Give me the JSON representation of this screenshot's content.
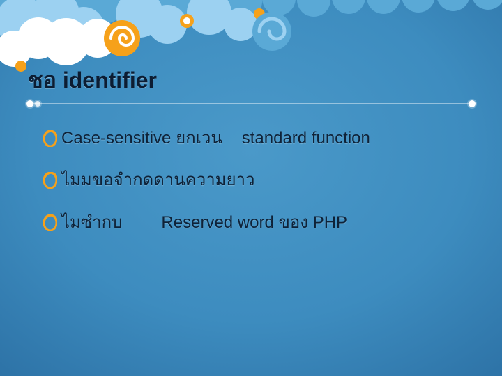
{
  "title": "ชอ      identifier",
  "bullets": [
    {
      "pre": "Case-sensitive ยกเวน",
      "post": "standard function"
    },
    {
      "pre": "ไมมขอจำกดดานความยาว",
      "post": ""
    },
    {
      "pre": "ไมซำกบ",
      "post": "Reserved word ของ PHP"
    }
  ],
  "colors": {
    "accent": "#f6a11a",
    "cloud_blue": "#8fcaf0",
    "cloud_mid": "#59a9d8"
  }
}
